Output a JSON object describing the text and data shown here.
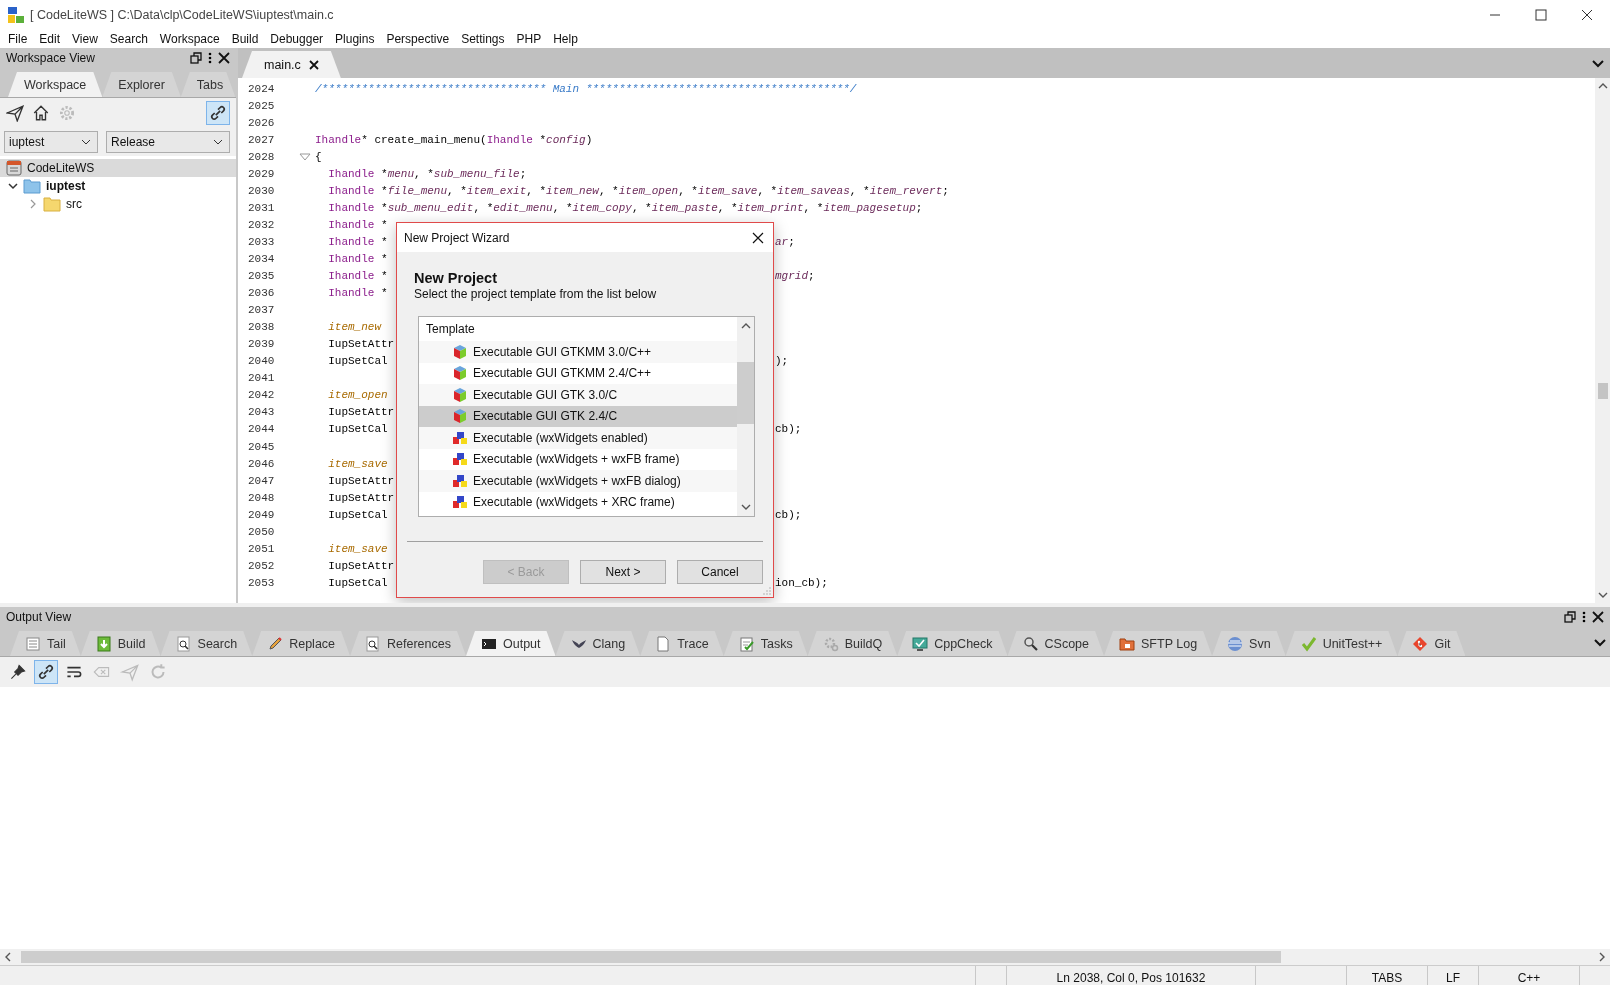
{
  "window": {
    "title": "[ CodeLiteWS ] C:\\Data\\clp\\CodeLiteWS\\iuptest\\main.c"
  },
  "menu": [
    "File",
    "Edit",
    "View",
    "Search",
    "Workspace",
    "Build",
    "Debugger",
    "Plugins",
    "Perspective",
    "Settings",
    "PHP",
    "Help"
  ],
  "workspace_view": {
    "title": "Workspace View",
    "tabs": [
      {
        "label": "Workspace",
        "selected": true
      },
      {
        "label": "Explorer",
        "selected": false
      },
      {
        "label": "Tabs",
        "selected": false
      }
    ],
    "tools": [
      {
        "kind": "send",
        "disabled": false
      },
      {
        "kind": "home",
        "disabled": false
      },
      {
        "kind": "settings",
        "disabled": true
      }
    ],
    "link_toggle": {
      "on": true
    },
    "project_select": "iuptest",
    "config_select": "Release",
    "workspace": {
      "label": "CodeLiteWS",
      "selected": true
    },
    "tree": [
      {
        "label": "iuptest",
        "active": true,
        "expanded": true,
        "selected": false,
        "children": [
          {
            "label": "src",
            "active": false,
            "expanded": false,
            "selected": false
          }
        ]
      }
    ]
  },
  "editor": {
    "tabs": [
      {
        "label": "main.c",
        "selected": true
      }
    ],
    "lines": [
      {
        "n": "2024",
        "tokens": [
          {
            "kind": "comment",
            "text": "/********************************** Main ****************************************/"
          }
        ]
      },
      {
        "n": "2025"
      },
      {
        "n": "2026"
      },
      {
        "n": "2027",
        "tokens": [
          {
            "kind": "type",
            "text": "Ihandle"
          },
          {
            "kind": "plain",
            "text": "* create_main_menu("
          },
          {
            "kind": "type",
            "text": "Ihandle"
          },
          {
            "kind": "plain",
            "text": " *"
          },
          {
            "kind": "var",
            "text": "config"
          },
          {
            "kind": "plain",
            "text": ")"
          }
        ]
      },
      {
        "n": "2028",
        "fold": true,
        "tokens": [
          {
            "kind": "plain",
            "text": "{"
          }
        ]
      },
      {
        "n": "2029",
        "tokens": [
          {
            "kind": "type",
            "text": "  Ihandle"
          },
          {
            "kind": "plain",
            "text": " *"
          },
          {
            "kind": "var",
            "text": "menu"
          },
          {
            "kind": "plain",
            "text": ", *"
          },
          {
            "kind": "var",
            "text": "sub_menu_file"
          },
          {
            "kind": "plain",
            "text": ";"
          }
        ]
      },
      {
        "n": "2030",
        "tokens": [
          {
            "kind": "type",
            "text": "  Ihandle"
          },
          {
            "kind": "plain",
            "text": " *"
          },
          {
            "kind": "var",
            "text": "file_menu"
          },
          {
            "kind": "plain",
            "text": ", *"
          },
          {
            "kind": "var",
            "text": "item_exit"
          },
          {
            "kind": "plain",
            "text": ", *"
          },
          {
            "kind": "var",
            "text": "item_new"
          },
          {
            "kind": "plain",
            "text": ", *"
          },
          {
            "kind": "var",
            "text": "item_open"
          },
          {
            "kind": "plain",
            "text": ", *"
          },
          {
            "kind": "var",
            "text": "item_save"
          },
          {
            "kind": "plain",
            "text": ", *"
          },
          {
            "kind": "var",
            "text": "item_saveas"
          },
          {
            "kind": "plain",
            "text": ", *"
          },
          {
            "kind": "var",
            "text": "item_revert"
          },
          {
            "kind": "plain",
            "text": ";"
          }
        ]
      },
      {
        "n": "2031",
        "tokens": [
          {
            "kind": "type",
            "text": "  Ihandle"
          },
          {
            "kind": "plain",
            "text": " *"
          },
          {
            "kind": "var",
            "text": "sub_menu_edit"
          },
          {
            "kind": "plain",
            "text": ", *"
          },
          {
            "kind": "var",
            "text": "edit_menu"
          },
          {
            "kind": "plain",
            "text": ", *"
          },
          {
            "kind": "var",
            "text": "item_copy"
          },
          {
            "kind": "plain",
            "text": ", *"
          },
          {
            "kind": "var",
            "text": "item_paste"
          },
          {
            "kind": "plain",
            "text": ", *"
          },
          {
            "kind": "var",
            "text": "item_print"
          },
          {
            "kind": "plain",
            "text": ", *"
          },
          {
            "kind": "var",
            "text": "item_pagesetup"
          },
          {
            "kind": "plain",
            "text": ";"
          }
        ]
      },
      {
        "n": "2032",
        "tokens": [
          {
            "kind": "type",
            "text": "  Ihandle"
          },
          {
            "kind": "plain",
            "text": " *"
          }
        ]
      },
      {
        "n": "2033",
        "tokens": [
          {
            "kind": "type",
            "text": "  Ihandle"
          },
          {
            "kind": "plain",
            "text": " *"
          }
        ],
        "after": [
          {
            "kind": "var",
            "text": "ar"
          },
          {
            "kind": "plain",
            "text": ";"
          }
        ]
      },
      {
        "n": "2034",
        "tokens": [
          {
            "kind": "type",
            "text": "  Ihandle"
          },
          {
            "kind": "plain",
            "text": " *"
          }
        ]
      },
      {
        "n": "2035",
        "tokens": [
          {
            "kind": "type",
            "text": "  Ihandle"
          },
          {
            "kind": "plain",
            "text": " *"
          }
        ],
        "after": [
          {
            "kind": "var",
            "text": "mgrid"
          },
          {
            "kind": "plain",
            "text": ";"
          }
        ]
      },
      {
        "n": "2036",
        "tokens": [
          {
            "kind": "type",
            "text": "  Ihandle"
          },
          {
            "kind": "plain",
            "text": " *"
          }
        ]
      },
      {
        "n": "2037"
      },
      {
        "n": "2038",
        "tokens": [
          {
            "kind": "local",
            "text": "  item_new"
          }
        ]
      },
      {
        "n": "2039",
        "tokens": [
          {
            "kind": "plain",
            "text": "  IupSetAttr"
          }
        ]
      },
      {
        "n": "2040",
        "tokens": [
          {
            "kind": "plain",
            "text": "  IupSetCal"
          }
        ],
        "after": [
          {
            "kind": "plain",
            "text": ");"
          }
        ]
      },
      {
        "n": "2041"
      },
      {
        "n": "2042",
        "tokens": [
          {
            "kind": "local",
            "text": "  item_open"
          }
        ]
      },
      {
        "n": "2043",
        "tokens": [
          {
            "kind": "plain",
            "text": "  IupSetAttr"
          }
        ]
      },
      {
        "n": "2044",
        "tokens": [
          {
            "kind": "plain",
            "text": "  IupSetCal"
          }
        ],
        "after": [
          {
            "kind": "plain",
            "text": "cb);"
          }
        ]
      },
      {
        "n": "2045"
      },
      {
        "n": "2046",
        "tokens": [
          {
            "kind": "local",
            "text": "  item_save"
          }
        ]
      },
      {
        "n": "2047",
        "tokens": [
          {
            "kind": "plain",
            "text": "  IupSetAttr"
          }
        ]
      },
      {
        "n": "2048",
        "tokens": [
          {
            "kind": "plain",
            "text": "  IupSetAttr"
          }
        ]
      },
      {
        "n": "2049",
        "tokens": [
          {
            "kind": "plain",
            "text": "  IupSetCal"
          }
        ],
        "after": [
          {
            "kind": "plain",
            "text": "cb);"
          }
        ]
      },
      {
        "n": "2050"
      },
      {
        "n": "2051",
        "tokens": [
          {
            "kind": "local",
            "text": "  item_save"
          }
        ]
      },
      {
        "n": "2052",
        "tokens": [
          {
            "kind": "plain",
            "text": "  IupSetAttr"
          }
        ]
      },
      {
        "n": "2053",
        "tokens": [
          {
            "kind": "plain",
            "text": "  IupSetCal"
          }
        ],
        "after": [
          {
            "kind": "plain",
            "text": "ion_cb);"
          }
        ]
      }
    ]
  },
  "dialog": {
    "title": "New Project Wizard",
    "heading": "New Project",
    "subtitle": "Select the project template from the list below",
    "list_header": "Template",
    "templates": [
      {
        "label": "Executable GUI GTKMM 3.0/C++",
        "kind": "cube",
        "selected": false
      },
      {
        "label": "Executable GUI GTKMM 2.4/C++",
        "kind": "cube",
        "selected": false
      },
      {
        "label": "Executable GUI GTK 3.0/C",
        "kind": "cube",
        "selected": false
      },
      {
        "label": "Executable GUI GTK 2.4/C",
        "kind": "cube",
        "selected": true
      },
      {
        "label": "Executable (wxWidgets enabled)",
        "kind": "blocks",
        "selected": false
      },
      {
        "label": "Executable (wxWidgets + wxFB frame)",
        "kind": "blocks",
        "selected": false
      },
      {
        "label": "Executable (wxWidgets + wxFB dialog)",
        "kind": "blocks",
        "selected": false
      },
      {
        "label": "Executable (wxWidgets + XRC frame)",
        "kind": "blocks",
        "selected": false
      }
    ],
    "buttons": [
      {
        "label": "< Back",
        "disabled": true
      },
      {
        "label": "Next >",
        "disabled": false
      },
      {
        "label": "Cancel",
        "disabled": false
      }
    ]
  },
  "output_view": {
    "title": "Output View",
    "tabs": [
      {
        "label": "Tail",
        "selected": false
      },
      {
        "label": "Build",
        "selected": false
      },
      {
        "label": "Search",
        "selected": false
      },
      {
        "label": "Replace",
        "selected": false
      },
      {
        "label": "References",
        "selected": false
      },
      {
        "label": "Output",
        "selected": true
      },
      {
        "label": "Clang",
        "selected": false
      },
      {
        "label": "Trace",
        "selected": false
      },
      {
        "label": "Tasks",
        "selected": false
      },
      {
        "label": "BuildQ",
        "selected": false
      },
      {
        "label": "CppCheck",
        "selected": false
      },
      {
        "label": "CScope",
        "selected": false
      },
      {
        "label": "SFTP Log",
        "selected": false
      },
      {
        "label": "Svn",
        "selected": false
      },
      {
        "label": "UnitTest++",
        "selected": false
      },
      {
        "label": "Git",
        "selected": false
      }
    ],
    "tools": [
      {
        "kind": "pin",
        "disabled": false,
        "on": false
      },
      {
        "kind": "link",
        "disabled": false,
        "on": true
      },
      {
        "kind": "wrap",
        "disabled": false,
        "on": false
      },
      {
        "kind": "clear",
        "disabled": true,
        "on": false
      },
      {
        "kind": "send",
        "disabled": true,
        "on": false
      },
      {
        "kind": "refresh",
        "disabled": true,
        "on": false
      }
    ]
  },
  "status_bar": {
    "position": "Ln 2038, Col 0, Pos 101632",
    "indent": "TABS",
    "eol": "LF",
    "language": "C++"
  }
}
